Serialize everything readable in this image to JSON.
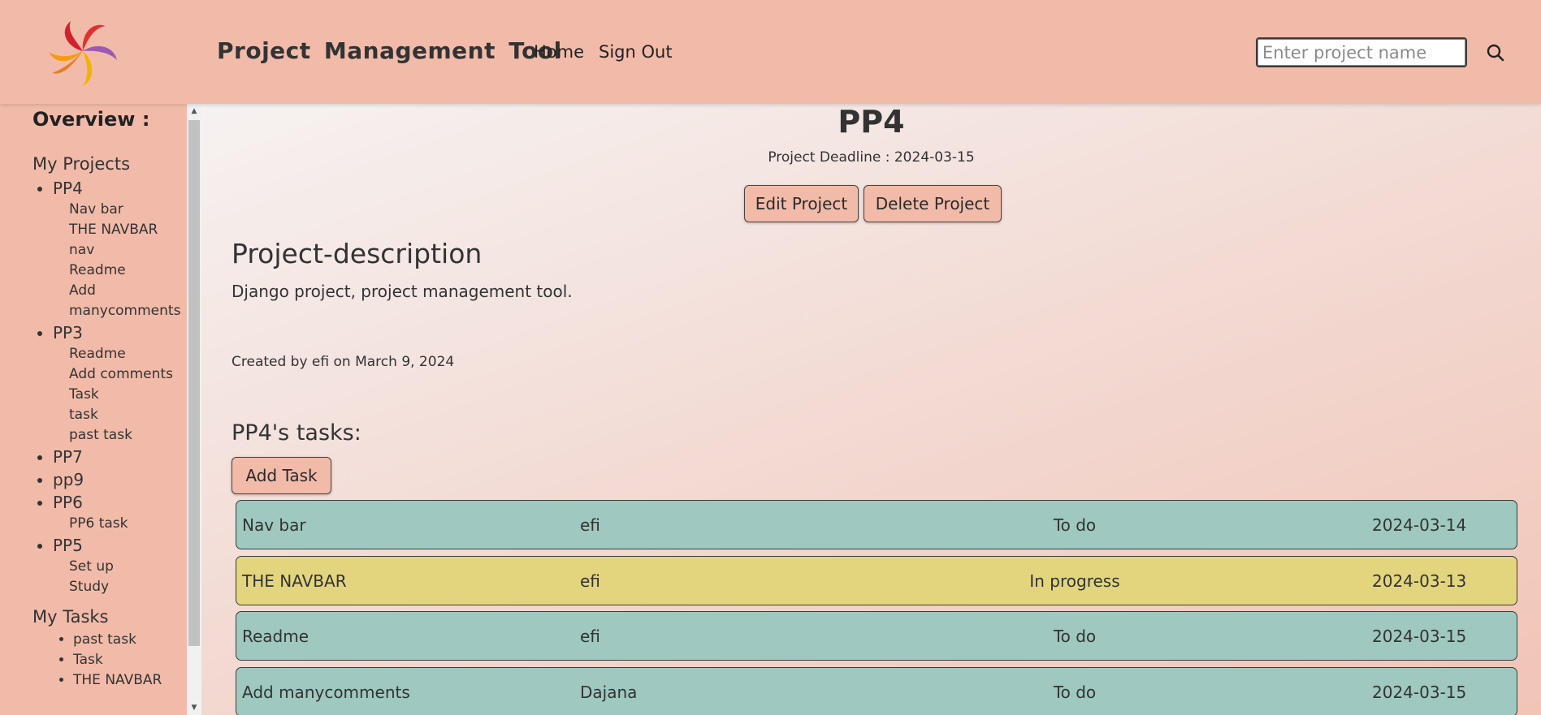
{
  "header": {
    "brand": "Project Management Tool",
    "nav": {
      "home": "Home",
      "sign_out": "Sign Out"
    },
    "search": {
      "placeholder": "Enter project name",
      "value": ""
    }
  },
  "sidebar": {
    "overview": "Overview :",
    "my_projects_label": "My Projects",
    "projects": [
      {
        "name": "PP4",
        "tasks": [
          "Nav bar",
          "THE NAVBAR",
          "nav",
          "Readme",
          "Add",
          "manycomments"
        ]
      },
      {
        "name": "PP3",
        "tasks": [
          "Readme",
          "Add comments",
          "Task",
          "task",
          "past task"
        ]
      },
      {
        "name": "PP7",
        "tasks": []
      },
      {
        "name": "pp9",
        "tasks": []
      },
      {
        "name": "PP6",
        "tasks": [
          "PP6 task"
        ]
      },
      {
        "name": "PP5",
        "tasks": [
          "Set up",
          "Study"
        ]
      }
    ],
    "my_tasks_label": "My Tasks",
    "my_tasks": [
      "past task",
      "Task",
      "THE NAVBAR"
    ]
  },
  "project": {
    "title": "PP4",
    "deadline": "Project Deadline : 2024-03-15",
    "edit_label": "Edit Project",
    "delete_label": "Delete Project",
    "description_heading": "Project-description",
    "description": "Django project, project management tool.",
    "created": "Created by efi on March 9, 2024",
    "tasks_heading": "PP4's tasks:",
    "add_task_label": "Add Task",
    "tasks": [
      {
        "name": "Nav bar",
        "user": "efi",
        "status": "To do",
        "date": "2024-03-14"
      },
      {
        "name": "THE NAVBAR",
        "user": "efi",
        "status": "In progress",
        "date": "2024-03-13"
      },
      {
        "name": "Readme",
        "user": "efi",
        "status": "To do",
        "date": "2024-03-15"
      },
      {
        "name": "Add manycomments",
        "user": "Dajana",
        "status": "To do",
        "date": "2024-03-15"
      }
    ]
  },
  "colors": {
    "header_bg": "#f2bba9",
    "todo_row": "#9ec8c0",
    "progress_row": "#e3d57e"
  }
}
